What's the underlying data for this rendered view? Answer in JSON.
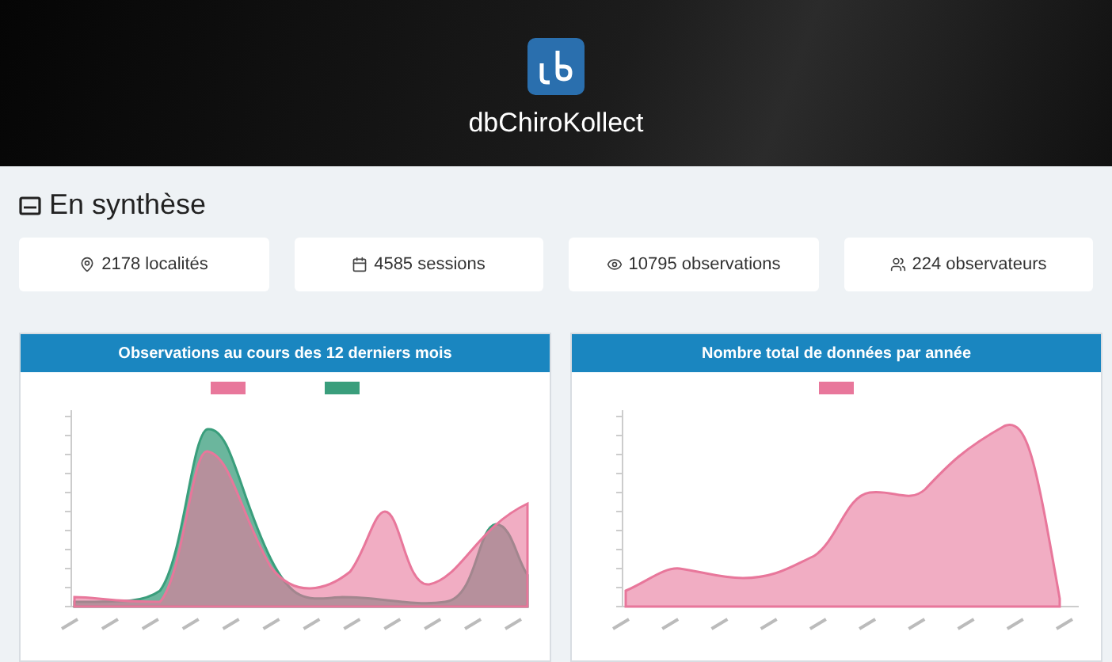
{
  "header": {
    "title": "dbChiroKollect"
  },
  "summary": {
    "title": "En synthèse"
  },
  "stats": [
    {
      "kind": "place",
      "text": "2178 localités"
    },
    {
      "kind": "calendar",
      "text": "4585 sessions"
    },
    {
      "kind": "eye",
      "text": "10795 observations"
    },
    {
      "kind": "people",
      "text": "224 observateurs"
    }
  ],
  "charts": [
    {
      "title": "Observations au cours des 12 derniers mois",
      "kind": "monthly",
      "legend": [
        {
          "color": "#e8779b"
        },
        {
          "color": "#3a9e7c"
        }
      ]
    },
    {
      "title": "Nombre total de données par année",
      "kind": "yearly",
      "legend": [
        {
          "color": "#e8779b"
        }
      ]
    }
  ]
}
